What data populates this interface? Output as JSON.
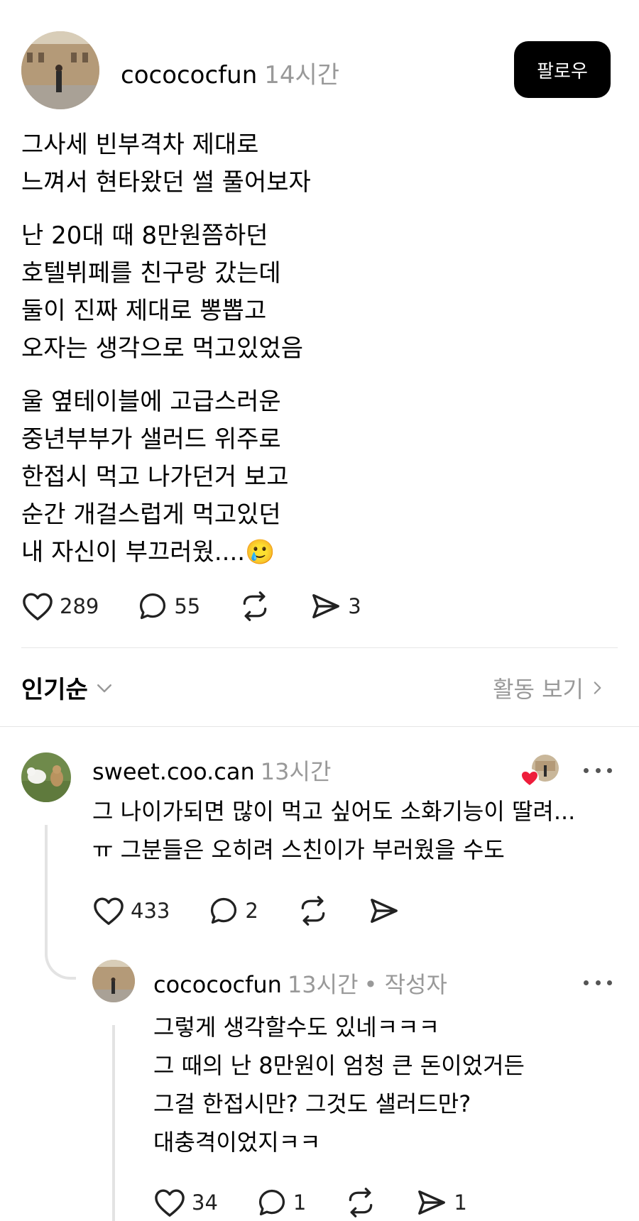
{
  "post": {
    "username": "cocococfun",
    "time": "14시간",
    "follow_label": "팔로우",
    "paragraphs": [
      [
        "그사세 빈부격차 제대로",
        "느껴서 현타왔던 썰 풀어보자"
      ],
      [
        "난 20대 때 8만원쯤하던",
        "호텔뷔페를 친구랑 갔는데",
        "둘이 진짜 제대로 뽕뽑고",
        "오자는 생각으로 먹고있었음"
      ],
      [
        "울 옆테이블에 고급스러운",
        "중년부부가 샐러드 위주로",
        "한접시 먹고 나가던거 보고",
        "순간 개걸스럽게 먹고있던",
        "내 자신이 부끄러웠....🥲"
      ]
    ],
    "likes": "289",
    "comments": "55",
    "shares": "3"
  },
  "sort": {
    "label": "인기순",
    "activity_label": "활동 보기"
  },
  "comments": [
    {
      "username": "sweet.coo.can",
      "time": "13시간",
      "lines": [
        "그 나이가되면 많이 먹고 싶어도 소화기능이 딸려...",
        "ㅠ 그분들은 오히려 스친이가 부러웠을 수도"
      ],
      "likes": "433",
      "replies": "2"
    },
    {
      "username": "cocococfun",
      "time": "13시간",
      "author_badge": "• 작성자",
      "lines": [
        "그렇게 생각할수도 있네ㅋㅋㅋ",
        "그 때의 난 8만원이 엄청 큰 돈이었거든",
        "그걸 한접시만? 그것도 샐러드만?",
        "대충격이었지ㅋㅋ"
      ],
      "likes": "34",
      "replies": "1",
      "shares": "1"
    }
  ]
}
